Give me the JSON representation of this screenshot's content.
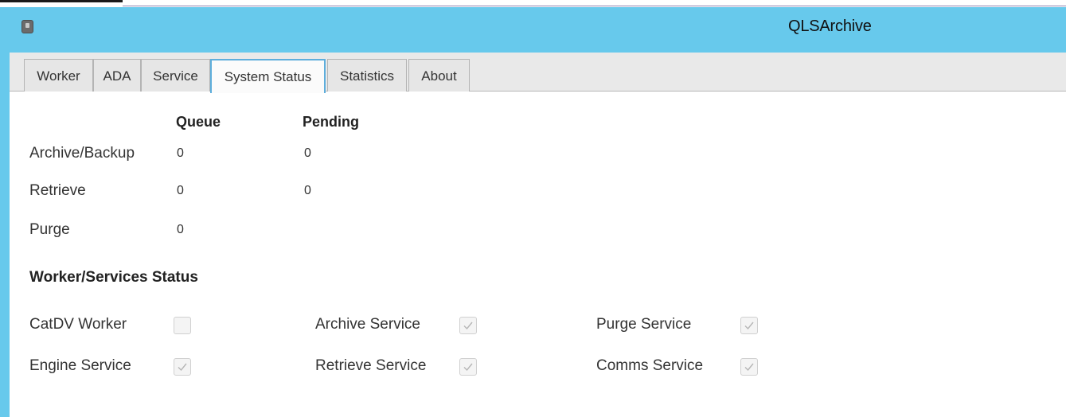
{
  "window": {
    "title": "QLSArchive"
  },
  "tabs": [
    {
      "label": "Worker",
      "active": false
    },
    {
      "label": "ADA",
      "active": false
    },
    {
      "label": "Service",
      "active": false
    },
    {
      "label": "System Status",
      "active": true
    },
    {
      "label": "Statistics",
      "active": false
    },
    {
      "label": "About",
      "active": false
    }
  ],
  "queue_table": {
    "headers": {
      "queue": "Queue",
      "pending": "Pending"
    },
    "rows": [
      {
        "label": "Archive/Backup",
        "queue": "0",
        "pending": "0"
      },
      {
        "label": "Retrieve",
        "queue": "0",
        "pending": "0"
      },
      {
        "label": "Purge",
        "queue": "0",
        "pending": ""
      }
    ]
  },
  "status_section": {
    "heading": "Worker/Services Status",
    "items": [
      {
        "label": "CatDV Worker",
        "checked": false
      },
      {
        "label": "Archive Service",
        "checked": true
      },
      {
        "label": "Purge Service",
        "checked": true
      },
      {
        "label": "Engine Service",
        "checked": true
      },
      {
        "label": "Retrieve Service",
        "checked": true
      },
      {
        "label": "Comms Service",
        "checked": true
      }
    ]
  },
  "colors": {
    "titlebar": "#67c9ec",
    "active_tab_border": "#5eaedc",
    "checkmark": "#b5b5b5"
  }
}
